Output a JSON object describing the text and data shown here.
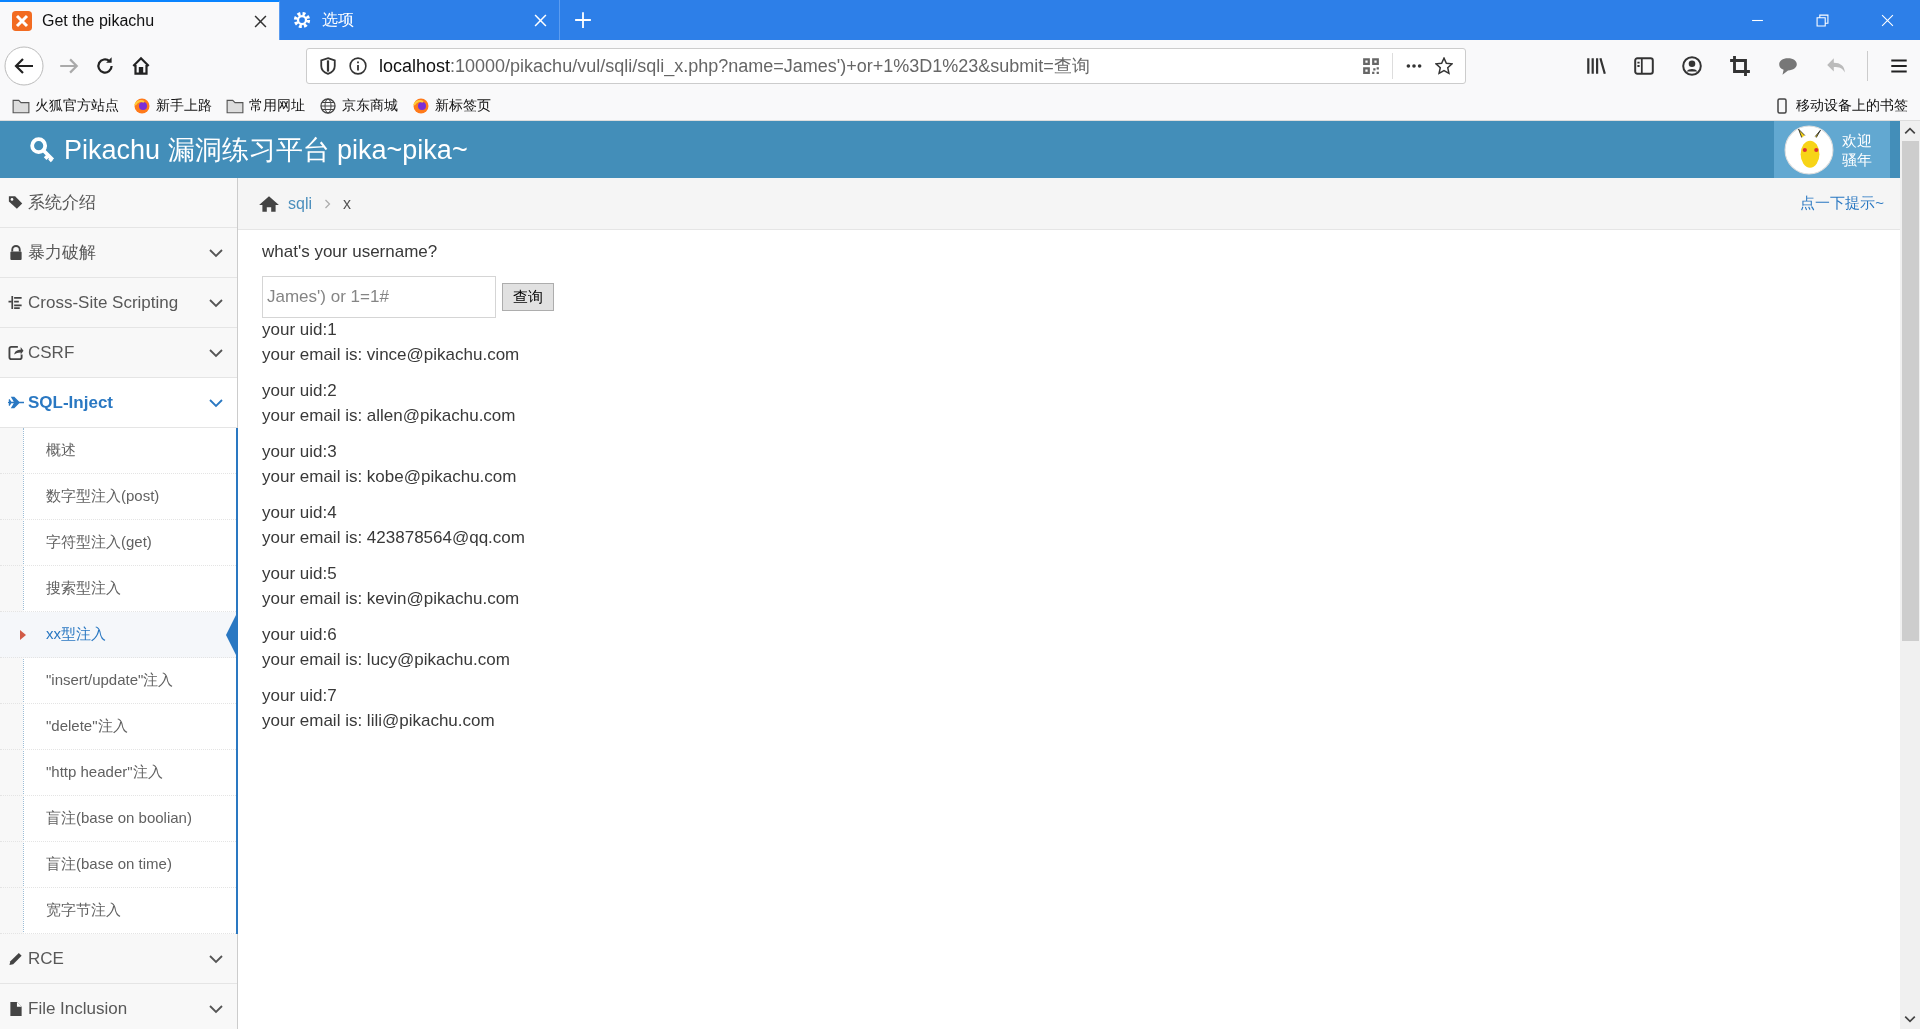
{
  "browser": {
    "tabs": [
      {
        "title": "Get the pikachu",
        "kind": "page",
        "selected": true
      },
      {
        "title": "选项",
        "kind": "settings",
        "selected": false
      }
    ],
    "url": {
      "host": "localhost",
      "path": ":10000/pikachu/vul/sqli/sqli_x.php?name=James')+or+1%3D1%23&submit=查询"
    },
    "bookmarks": [
      {
        "label": "火狐官方站点",
        "kind": "folder"
      },
      {
        "label": "新手上路",
        "kind": "firefox"
      },
      {
        "label": "常用网址",
        "kind": "folder"
      },
      {
        "label": "京东商城",
        "kind": "globe"
      },
      {
        "label": "新标签页",
        "kind": "firefox"
      }
    ],
    "mobile_bookmarks": "移动设备上的书签"
  },
  "header": {
    "title": "Pikachu 漏洞练习平台 pika~pika~",
    "greeting": [
      "欢迎",
      "骚年"
    ]
  },
  "sidebar": [
    {
      "label": "系统介绍",
      "kind": "tag",
      "selected": false
    },
    {
      "label": "暴力破解",
      "kind": "lock",
      "selected": false
    },
    {
      "label": "Cross-Site Scripting",
      "kind": "list",
      "selected": false
    },
    {
      "label": "CSRF",
      "kind": "share",
      "selected": false
    },
    {
      "label": "SQL-Inject",
      "kind": "plane",
      "selected": true,
      "children": [
        {
          "label": "概述",
          "selected": false
        },
        {
          "label": "数字型注入(post)",
          "selected": false
        },
        {
          "label": "字符型注入(get)",
          "selected": false
        },
        {
          "label": "搜索型注入",
          "selected": false
        },
        {
          "label": "xx型注入",
          "selected": true
        },
        {
          "label": "\"insert/update\"注入",
          "selected": false
        },
        {
          "label": "\"delete\"注入",
          "selected": false
        },
        {
          "label": "\"http header\"注入",
          "selected": false
        },
        {
          "label": "盲注(base on boolian)",
          "selected": false
        },
        {
          "label": "盲注(base on time)",
          "selected": false
        },
        {
          "label": "宽字节注入",
          "selected": false
        }
      ]
    },
    {
      "label": "RCE",
      "kind": "pencil",
      "selected": false
    },
    {
      "label": "File Inclusion",
      "kind": "file",
      "selected": false
    }
  ],
  "breadcrumb": [
    "sqli",
    "x"
  ],
  "hint": "点一下提示~",
  "form": {
    "prompt": "what's your username?",
    "value": "James') or 1=1#",
    "button": "查询"
  },
  "results": [
    {
      "uid": "your uid:1",
      "email": "your email is: vince@pikachu.com"
    },
    {
      "uid": "your uid:2",
      "email": "your email is: allen@pikachu.com"
    },
    {
      "uid": "your uid:3",
      "email": "your email is: kobe@pikachu.com"
    },
    {
      "uid": "your uid:4",
      "email": "your email is: 423878564@qq.com"
    },
    {
      "uid": "your uid:5",
      "email": "your email is: kevin@pikachu.com"
    },
    {
      "uid": "your uid:6",
      "email": "your email is: lucy@pikachu.com"
    },
    {
      "uid": "your uid:7",
      "email": "your email is: lili@pikachu.com"
    }
  ]
}
